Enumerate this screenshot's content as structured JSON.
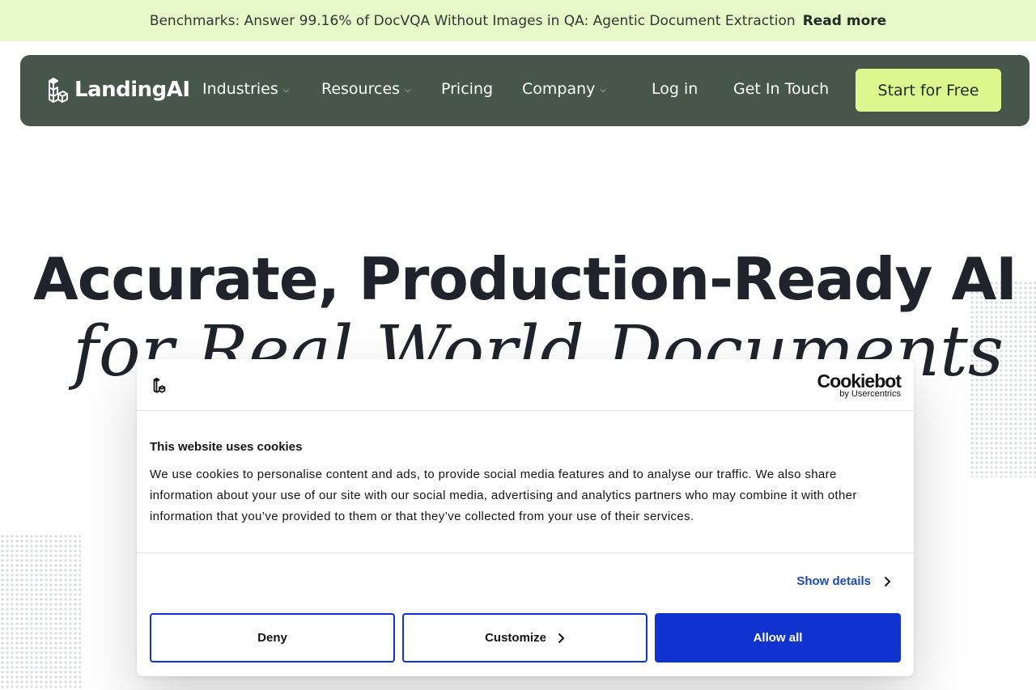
{
  "announcement": {
    "text": "Benchmarks: Answer 99.16% of DocVQA Without Images in QA: Agentic Document Extraction",
    "link": "Read more"
  },
  "nav": {
    "brand": "LandingAI",
    "items": [
      {
        "label": "Industries",
        "has_dropdown": true
      },
      {
        "label": "Resources",
        "has_dropdown": true
      },
      {
        "label": "Pricing",
        "has_dropdown": false
      },
      {
        "label": "Company",
        "has_dropdown": true
      }
    ],
    "login": "Log in",
    "contact": "Get In Touch",
    "cta": "Start for Free",
    "chevron": "⌄"
  },
  "hero": {
    "title": "Accurate, Production-Ready AI",
    "subtitle": "for Real World Documents"
  },
  "cookie_dialog": {
    "brand_big": "Cookiebot",
    "brand_small": "by Usercentrics",
    "title": "This website uses cookies",
    "body": "We use cookies to personalise content and ads, to provide social media features and to analyse our traffic. We also share information about your use of our site with our social media, advertising and analytics partners who may combine it with other information that you’ve provided to them or that they’ve collected from your use of their services.",
    "show_details": "Show details",
    "deny": "Deny",
    "customize": "Customize",
    "allow_all": "Allow all"
  },
  "colors": {
    "announce_bg": "#e6f7c8",
    "nav_bg": "#46564b",
    "cta_bg": "#dcf78e",
    "primary_blue": "#1032cf",
    "link_blue": "#1a4ab8"
  },
  "icons": [
    "landingai-logo-icon",
    "chevron-down-icon",
    "chevron-right-icon"
  ]
}
